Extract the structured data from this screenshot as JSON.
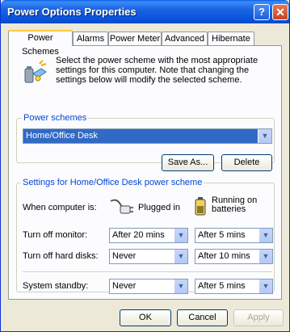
{
  "window": {
    "title": "Power Options Properties",
    "help_label": "?",
    "close_label": "✕"
  },
  "tabs": [
    {
      "label": "Power Schemes",
      "active": true
    },
    {
      "label": "Alarms",
      "active": false
    },
    {
      "label": "Power Meter",
      "active": false
    },
    {
      "label": "Advanced",
      "active": false
    },
    {
      "label": "Hibernate",
      "active": false
    }
  ],
  "intro": {
    "text": "Select the power scheme with the most appropriate settings for this computer. Note that changing the settings below will modify the selected scheme."
  },
  "schemes": {
    "group_label": "Power schemes",
    "selected": "Home/Office Desk",
    "save_as_label": "Save As...",
    "delete_label": "Delete"
  },
  "settings": {
    "group_label": "Settings for Home/Office Desk power scheme",
    "when_label": "When computer is:",
    "plugged_in_label": "Plugged in",
    "batteries_label": "Running on batteries",
    "rows": [
      {
        "label": "Turn off monitor:",
        "plugged": "After 20 mins",
        "battery": "After 5 mins"
      },
      {
        "label": "Turn off hard disks:",
        "plugged": "Never",
        "battery": "After 10 mins"
      },
      {
        "label": "System standby:",
        "plugged": "Never",
        "battery": "After 5 mins"
      }
    ]
  },
  "footer": {
    "ok_label": "OK",
    "cancel_label": "Cancel",
    "apply_label": "Apply"
  },
  "colors": {
    "title_bar": "#0a5fe8",
    "group_label": "#0046d5",
    "selection": "#316ac5"
  }
}
